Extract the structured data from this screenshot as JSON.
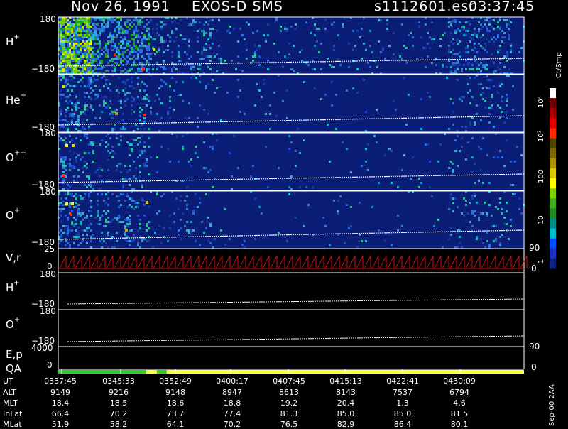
{
  "header": {
    "date": "Nov 26, 1991",
    "instrument": "EXOS-D SMS",
    "file": "s1112601.esr",
    "time": "03:37:45"
  },
  "panels": {
    "h_plus": {
      "label": "H",
      "charge": "+",
      "ymax": "180",
      "ymin": "−180"
    },
    "he_plus": {
      "label": "He",
      "charge": "+",
      "ymax": "180",
      "ymin": "−180"
    },
    "o_pp": {
      "label": "O",
      "charge": "++",
      "ymax": "180",
      "ymin": "−180"
    },
    "o_plus": {
      "label": "O",
      "charge": "+",
      "ymax": "180",
      "ymin": "−180"
    },
    "vr": {
      "label": "V,r",
      "ymax": "25",
      "ymin": "0",
      "right_top": "90",
      "right_bot": "0"
    },
    "h_plus_2": {
      "label": "H",
      "charge": "+",
      "ymax": "180",
      "ymin": "−180"
    },
    "o_plus_2": {
      "label": "O",
      "charge": "+",
      "ymax": "180",
      "ymin": "−180"
    },
    "ep": {
      "label": "E,p",
      "ymax": "4000",
      "ymin": "0",
      "right_top": "90",
      "right_bot": "0"
    },
    "qa": {
      "label": "QA"
    }
  },
  "colorbar": {
    "title": "Ct/Smp",
    "tick_labels": [
      "10⁴",
      "10³",
      "100",
      "10",
      "1"
    ],
    "colors": [
      "#ffffff",
      "#6b0000",
      "#a80000",
      "#e00000",
      "#ff2a00",
      "#4d4500",
      "#7a6a00",
      "#a89200",
      "#d9c800",
      "#ffff00",
      "#7fd000",
      "#40b020",
      "#208a20",
      "#008a8a",
      "#00c0d0",
      "#0050ff",
      "#2030c0",
      "#102080"
    ]
  },
  "footer": {
    "rows": [
      {
        "label": "UT",
        "values": [
          "0337:45",
          "0345:33",
          "0352:49",
          "0400:17",
          "0407:45",
          "0415:13",
          "0422:41",
          "0430:09"
        ]
      },
      {
        "label": "ALT",
        "values": [
          "9149",
          "9216",
          "9148",
          "8947",
          "8613",
          "8143",
          "7537",
          "6794"
        ]
      },
      {
        "label": "MLT",
        "values": [
          "18.4",
          "18.5",
          "18.6",
          "18.8",
          "19.2",
          "20.4",
          "1.3",
          "4.6"
        ]
      },
      {
        "label": "InLat",
        "values": [
          "66.4",
          "70.2",
          "73.7",
          "77.4",
          "81.3",
          "85.0",
          "85.0",
          "81.5"
        ]
      },
      {
        "label": "MLat",
        "values": [
          "51.9",
          "58.2",
          "64.1",
          "70.2",
          "76.5",
          "82.9",
          "86.4",
          "80.1"
        ]
      }
    ],
    "side_note": "Sep-00 2AA"
  },
  "chart_data": {
    "type": "heatmap",
    "title": "Nov 26, 1991   EXOS-D SMS",
    "x_ticks": [
      "0337:45",
      "0345:33",
      "0352:49",
      "0400:17",
      "0407:45",
      "0415:13",
      "0422:41",
      "0430:09"
    ],
    "colorbar_unit": "Ct/Smp",
    "colorbar_range": [
      1,
      10000
    ],
    "colorbar_scale": "log",
    "spectrogram_panels": [
      {
        "name": "H+",
        "ylim": [
          -180,
          180
        ]
      },
      {
        "name": "He+",
        "ylim": [
          -180,
          180
        ]
      },
      {
        "name": "O++",
        "ylim": [
          -180,
          180
        ]
      },
      {
        "name": "O+",
        "ylim": [
          -180,
          180
        ]
      }
    ],
    "line_panels": [
      {
        "name": "V,r",
        "ylim": [
          0,
          25
        ],
        "right_axis": [
          0,
          90
        ]
      },
      {
        "name": "H+",
        "ylim": [
          -180,
          180
        ]
      },
      {
        "name": "O+",
        "ylim": [
          -180,
          180
        ]
      },
      {
        "name": "E,p",
        "ylim": [
          0,
          4000
        ],
        "right_axis": [
          0,
          90
        ]
      }
    ],
    "qa_segments": [
      {
        "color": "#33cc33",
        "from": "0337:45",
        "to": "0348:20"
      },
      {
        "color": "#ffff44",
        "from": "0348:20",
        "to": "0349:40"
      },
      {
        "color": "#33cc33",
        "from": "0349:40",
        "to": "0350:50"
      },
      {
        "color": "#ffff44",
        "from": "0350:50",
        "to": "0434:00"
      }
    ]
  }
}
